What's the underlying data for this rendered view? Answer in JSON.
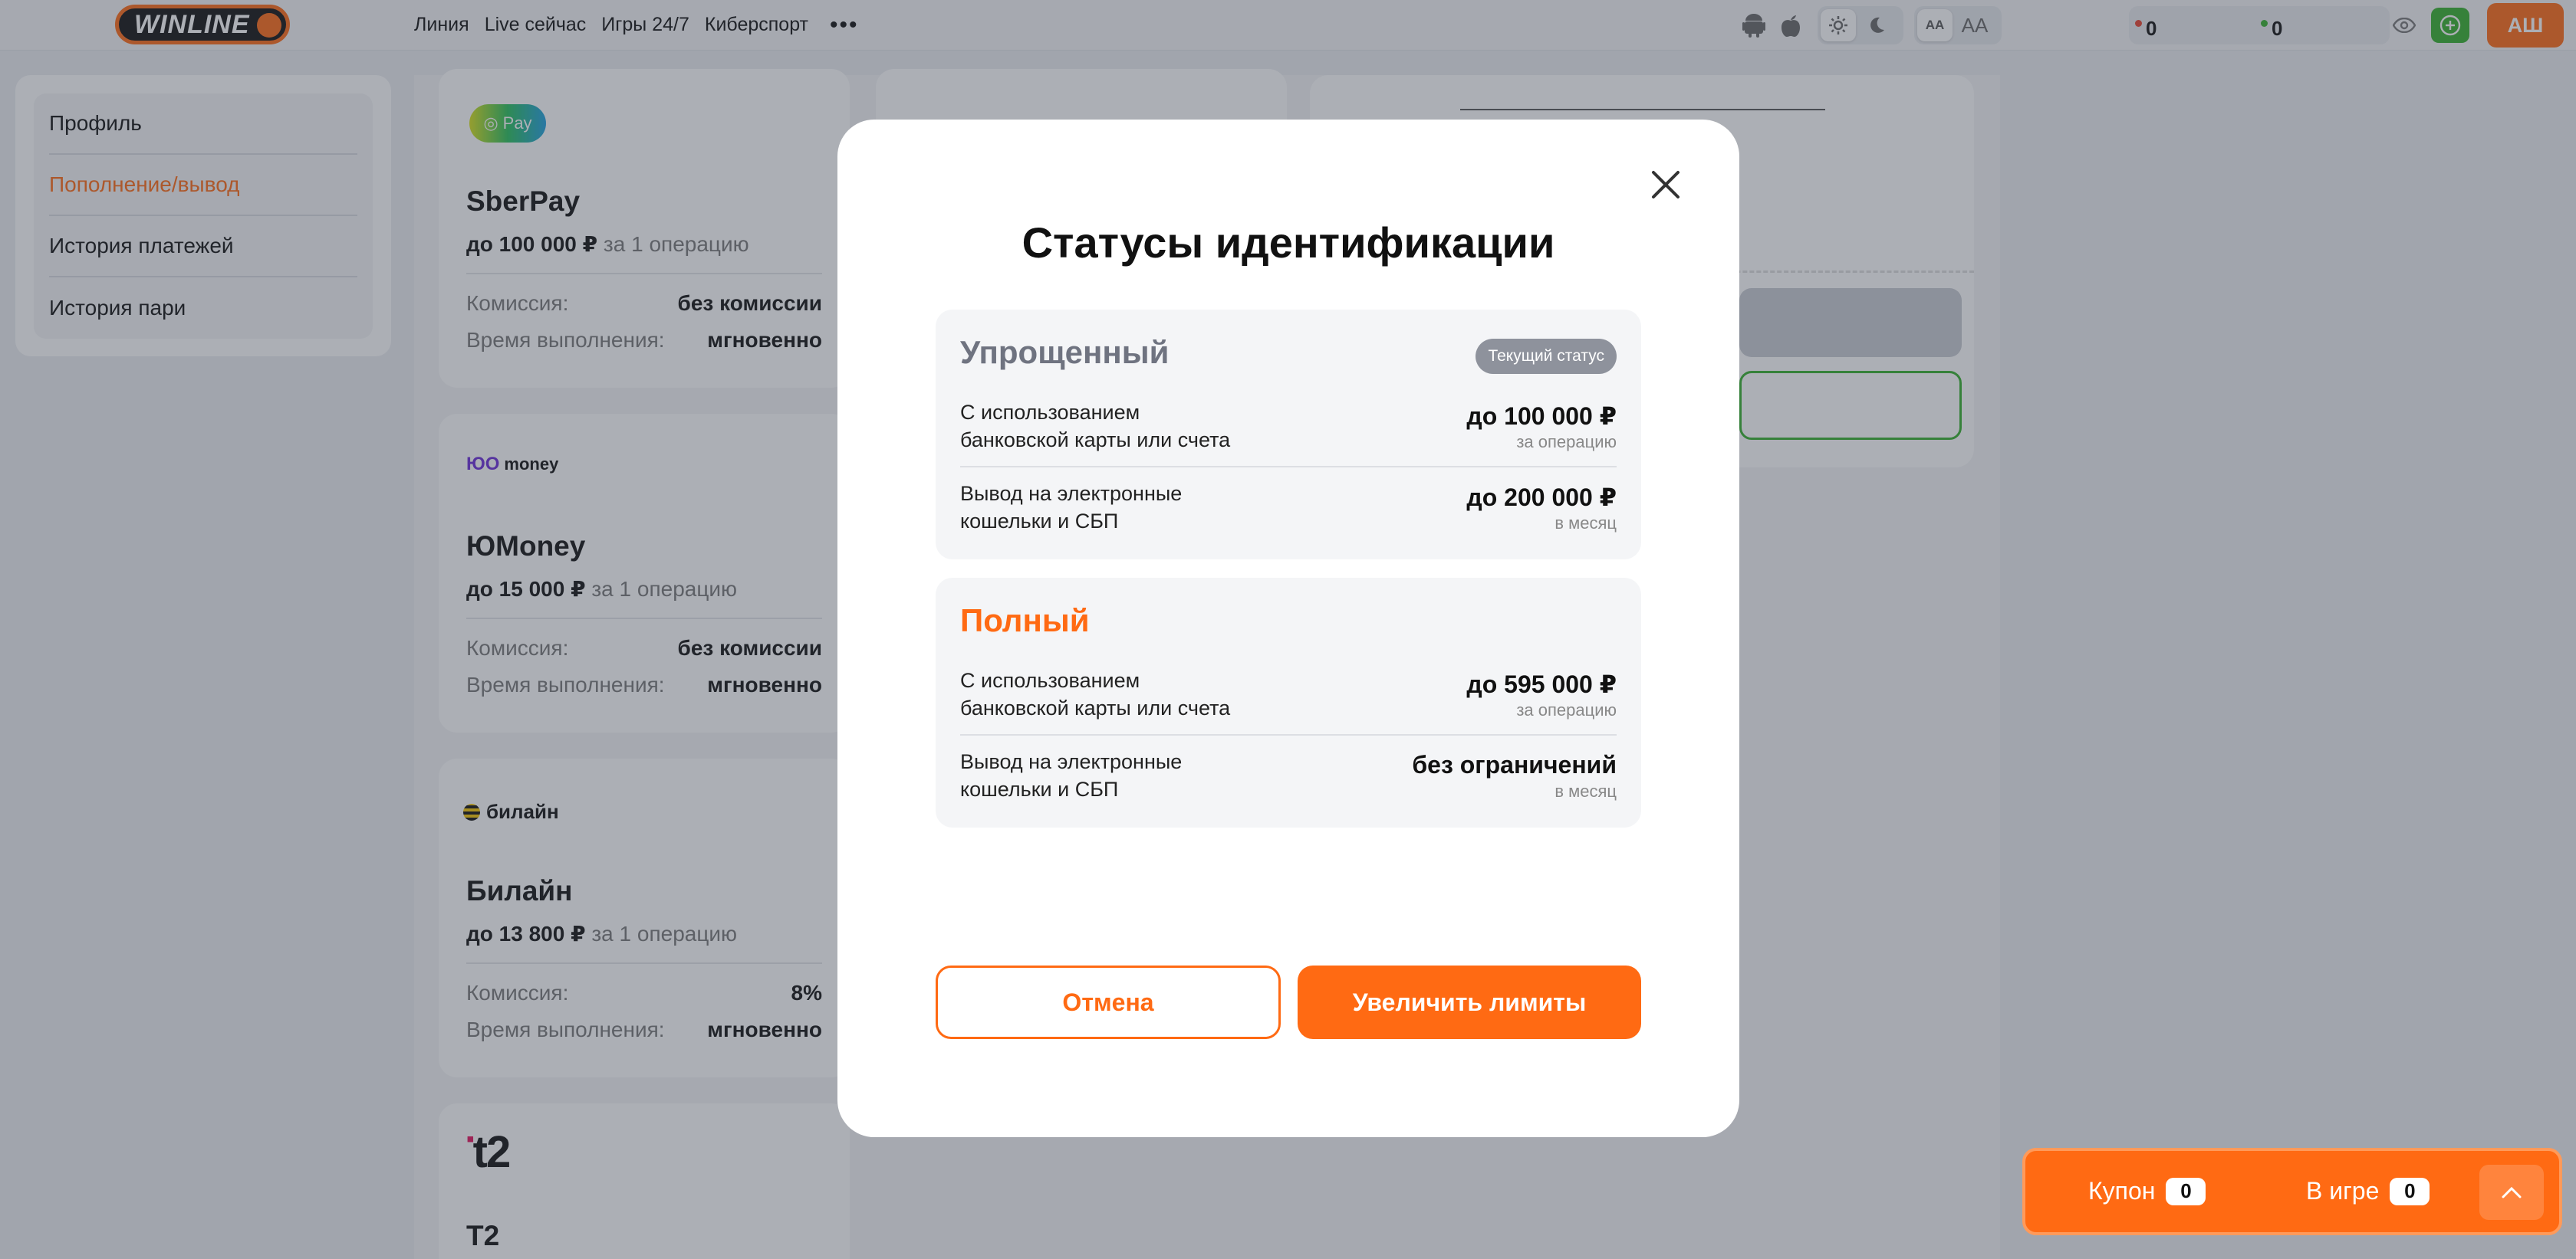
{
  "header": {
    "logo": "WINLINE",
    "nav": [
      "Линия",
      "Live сейчас",
      "Игры 24/7",
      "Киберспорт"
    ],
    "more_icon": "more-dots-icon",
    "platform_icons": [
      "android-icon",
      "apple-icon"
    ],
    "theme_icons": [
      "sun-icon",
      "moon-icon"
    ],
    "font_small": "AA",
    "font_large": "AA",
    "balance_1": "0",
    "balance_2": "0",
    "eye_icon": "eye-icon",
    "plus_icon": "plus-icon",
    "avatar": "АШ",
    "colors": {
      "accent": "#ff6a13",
      "green": "#35b02b",
      "red_dot": "#e8432e"
    }
  },
  "sidebar": {
    "items": [
      {
        "label": "Профиль"
      },
      {
        "label": "Пополнение/вывод",
        "active": true
      },
      {
        "label": "История платежей"
      },
      {
        "label": "История пари"
      }
    ]
  },
  "cards": [
    {
      "logo": "Pay",
      "name": "SberPay",
      "limit_amount": "до 100 000 ₽",
      "limit_suffix": "за 1 операцию",
      "commission_label": "Комиссия:",
      "commission": "без комиссии",
      "time_label": "Время выполнения:",
      "time": "мгновенно"
    },
    {
      "logo": "money",
      "name": "ЮMoney",
      "limit_amount": "до 15 000 ₽",
      "limit_suffix": "за 1 операцию",
      "commission_label": "Комиссия:",
      "commission": "без комиссии",
      "time_label": "Время выполнения:",
      "time": "мгновенно"
    },
    {
      "logo": "билайн",
      "name": "Билайн",
      "limit_amount": "до 13 800 ₽",
      "limit_suffix": "за 1 операцию",
      "commission_label": "Комиссия:",
      "commission": "8%",
      "time_label": "Время выполнения:",
      "time": "мгновенно"
    },
    {
      "logo": "t2",
      "name": "T2"
    }
  ],
  "modal": {
    "title": "Статусы идентификации",
    "close_icon": "close-icon",
    "statuses": [
      {
        "name": "Упрощенный",
        "badge": "Текущий статус",
        "rows": [
          {
            "desc": "С использованием банковской карты или счета",
            "amount": "до 100 000 ₽",
            "period": "за операцию"
          },
          {
            "desc": "Вывод на электронные кошельки и СБП",
            "amount": "до 200 000 ₽",
            "period": "в месяц"
          }
        ]
      },
      {
        "name": "Полный",
        "rows": [
          {
            "desc": "С использованием банковской карты или счета",
            "amount": "до 595 000 ₽",
            "period": "за операцию"
          },
          {
            "desc": "Вывод на электронные кошельки и СБП",
            "amount": "без ограничений",
            "period": "в месяц"
          }
        ]
      }
    ],
    "cancel_label": "Отмена",
    "raise_label": "Увеличить лимиты"
  },
  "coupon": {
    "coupon_label": "Купон",
    "coupon_count": "0",
    "ingame_label": "В игре",
    "ingame_count": "0",
    "expand_icon": "chevron-up-icon"
  }
}
